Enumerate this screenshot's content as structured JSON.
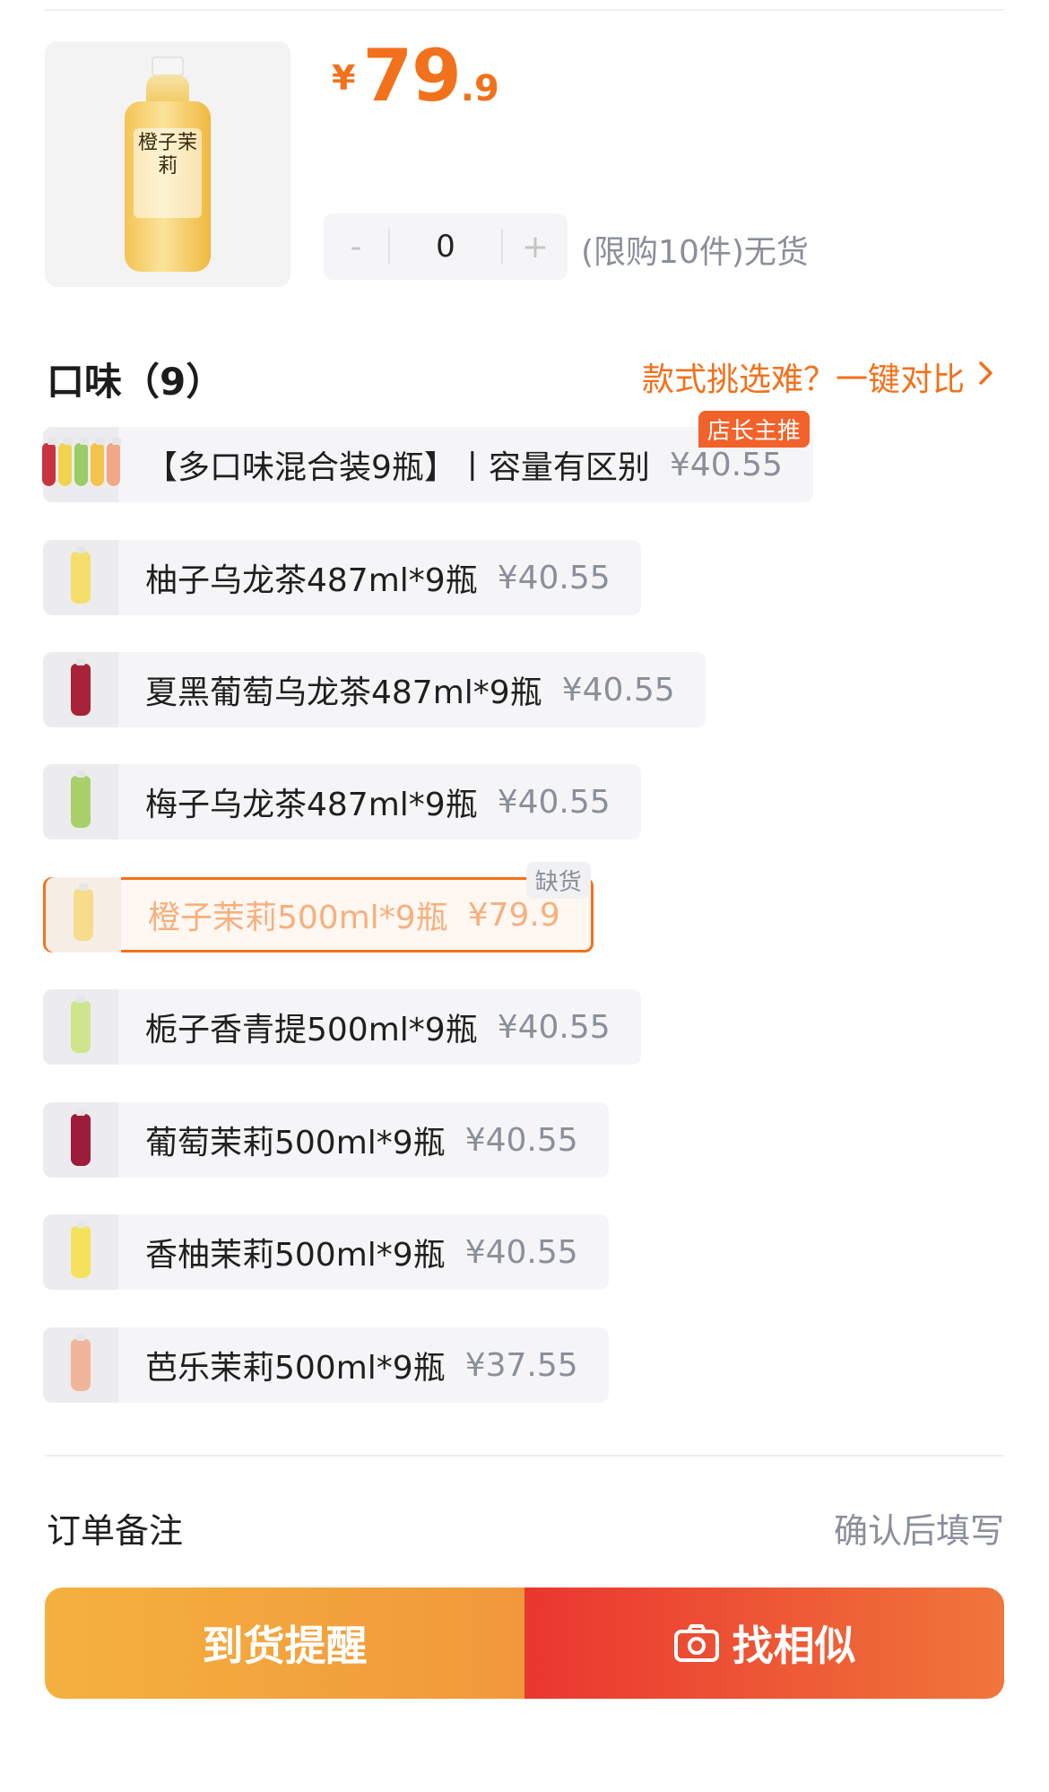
{
  "product": {
    "price_symbol": "¥",
    "price_integer": "79",
    "price_decimal": ".9",
    "thumb_label": "橙子茉莉"
  },
  "quantity": {
    "minus": "-",
    "value": "0",
    "plus": "+",
    "limit_text": "(限购10件)无货"
  },
  "flavor_section": {
    "title": "口味（9）",
    "compare_text": "款式挑选难？一键对比"
  },
  "options": [
    {
      "name": "【多口味混合装9瓶】丨容量有区别",
      "price": "¥40.55",
      "tag": "店长主推",
      "colors": [
        "#c7343f",
        "#f2d34f",
        "#9acd66",
        "#f4c34d",
        "#f0a887"
      ]
    },
    {
      "name": "柚子乌龙茶487ml*9瓶",
      "price": "¥40.55",
      "colors": [
        "#f5df6a"
      ]
    },
    {
      "name": "夏黑葡萄乌龙茶487ml*9瓶",
      "price": "¥40.55",
      "colors": [
        "#a82238"
      ]
    },
    {
      "name": "梅子乌龙茶487ml*9瓶",
      "price": "¥40.55",
      "colors": [
        "#a9d06a"
      ]
    },
    {
      "name": "橙子茉莉500ml*9瓶",
      "price": "¥79.9",
      "tag": "缺货",
      "selected": true,
      "colors": [
        "#f7dc8c"
      ]
    },
    {
      "name": "栀子香青提500ml*9瓶",
      "price": "¥40.55",
      "colors": [
        "#cfe48d"
      ]
    },
    {
      "name": "葡萄茉莉500ml*9瓶",
      "price": "¥40.55",
      "colors": [
        "#9e1c3b"
      ]
    },
    {
      "name": "香柚茉莉500ml*9瓶",
      "price": "¥40.55",
      "colors": [
        "#f4e25c"
      ]
    },
    {
      "name": "芭乐茉莉500ml*9瓶",
      "price": "¥37.55",
      "colors": [
        "#f1b59c"
      ]
    }
  ],
  "remark": {
    "label": "订单备注",
    "hint": "确认后填写"
  },
  "actions": {
    "notify": "到货提醒",
    "similar": "找相似"
  },
  "colors": {
    "accent": "#f2711c",
    "notify_button": "#f2a33d",
    "similar_button": "#eb4a33"
  }
}
